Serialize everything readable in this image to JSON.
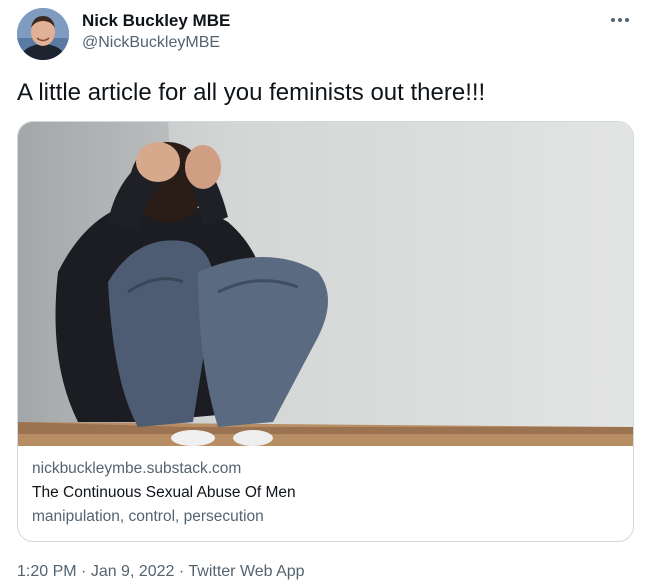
{
  "author": {
    "name": "Nick Buckley MBE",
    "handle": "@NickBuckleyMBE",
    "avatar_icon": "user-avatar"
  },
  "tweet": {
    "text": "A little article for all you feminists out there!!!"
  },
  "card": {
    "image_icon": "man-crouched-in-corner-photo",
    "domain": "nickbuckleymbe.substack.com",
    "title": "The Continuous Sexual Abuse Of Men",
    "description": "manipulation, control, persecution"
  },
  "meta": {
    "time": "1:20 PM",
    "separator": " · ",
    "date": "Jan 9, 2022",
    "source": "Twitter Web App"
  },
  "icons": {
    "more": "more-horizontal-icon"
  },
  "colors": {
    "text_primary": "#0f1419",
    "text_secondary": "#536471",
    "border": "#cfd9de"
  }
}
